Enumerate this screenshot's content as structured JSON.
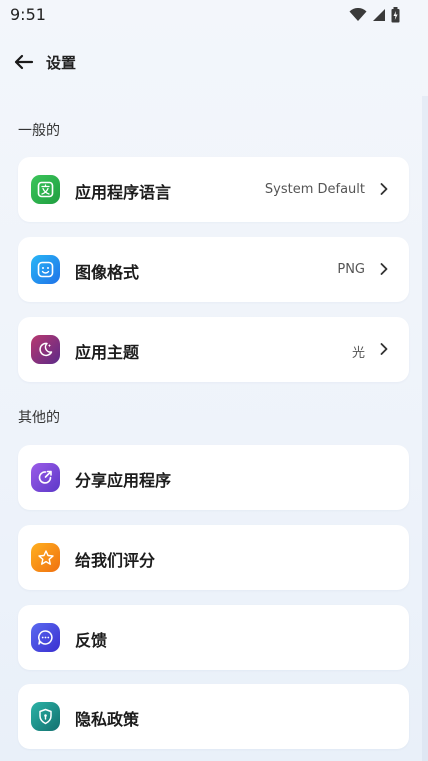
{
  "status_bar": {
    "time": "9:51"
  },
  "header": {
    "title": "设置"
  },
  "sections": {
    "general": {
      "label": "一般的",
      "items": [
        {
          "label": "应用程序语言",
          "value": "System Default",
          "icon": "translate-icon",
          "color": "#2fb34f"
        },
        {
          "label": "图像格式",
          "value": "PNG",
          "icon": "image-format-icon",
          "color": "#1f8ff0"
        },
        {
          "label": "应用主题",
          "value": "光",
          "icon": "moon-icon",
          "color": "#9b2f6d"
        }
      ]
    },
    "other": {
      "label": "其他的",
      "items": [
        {
          "label": "分享应用程序",
          "icon": "share-icon",
          "color": "#7a4fd8"
        },
        {
          "label": "给我们评分",
          "icon": "star-icon",
          "color": "#f59a12"
        },
        {
          "label": "反馈",
          "icon": "feedback-icon",
          "color": "#4a52e0"
        },
        {
          "label": "隐私政策",
          "icon": "shield-icon",
          "color": "#1f8f8b"
        }
      ]
    }
  }
}
